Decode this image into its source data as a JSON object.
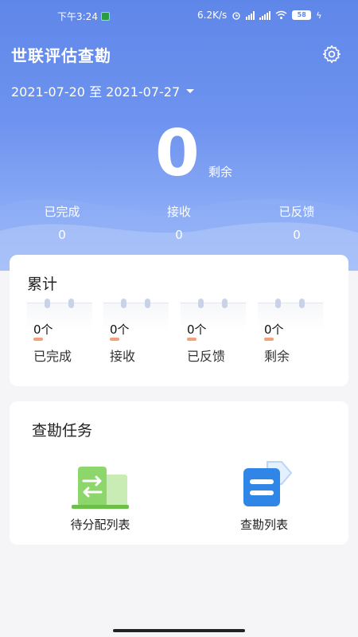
{
  "status_bar": {
    "time": "下午3:24",
    "net_speed": "6.2K/s",
    "battery": "58"
  },
  "header": {
    "title": "世联评估查勘",
    "settings_icon": "gear-icon",
    "date_range": "2021-07-20 至 2021-07-27"
  },
  "summary": {
    "remaining_value": "0",
    "remaining_label": "剩余",
    "stats": [
      {
        "label": "已完成",
        "value": "0"
      },
      {
        "label": "接收",
        "value": "0"
      },
      {
        "label": "已反馈",
        "value": "0"
      }
    ]
  },
  "cumulative": {
    "title": "累计",
    "tiles": [
      {
        "value": "0个",
        "label": "已完成"
      },
      {
        "value": "0个",
        "label": "接收"
      },
      {
        "value": "0个",
        "label": "已反馈"
      },
      {
        "value": "0个",
        "label": "剩余"
      }
    ]
  },
  "tasks": {
    "title": "查勘任务",
    "items": [
      {
        "label": "待分配列表",
        "icon": "transfer-icon"
      },
      {
        "label": "查勘列表",
        "icon": "list-icon"
      }
    ]
  },
  "colors": {
    "brand_blue": "#5f87e9",
    "accent_orange": "#f0a07a",
    "icon_green": "#8cd66b",
    "icon_blue": "#2f86e6"
  }
}
